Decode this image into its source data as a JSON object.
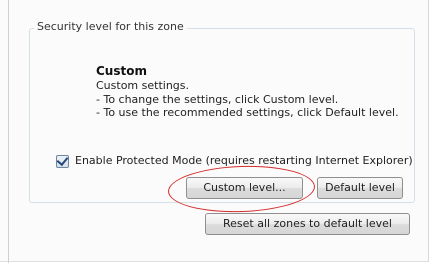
{
  "security_group": {
    "legend": "Security level for this zone",
    "level_title": "Custom",
    "level_lines": [
      "Custom settings.",
      "- To change the settings, click Custom level.",
      "- To use the recommended settings, click Default level."
    ]
  },
  "protected_mode": {
    "label": "Enable Protected Mode (requires restarting Internet Explorer)",
    "checked": true
  },
  "buttons": {
    "custom_level": "Custom level...",
    "default_level": "Default level",
    "reset_all": "Reset all zones to default level"
  },
  "annotation": {
    "highlight_color": "#d62a2a",
    "highlight_target": "custom-level-button"
  }
}
